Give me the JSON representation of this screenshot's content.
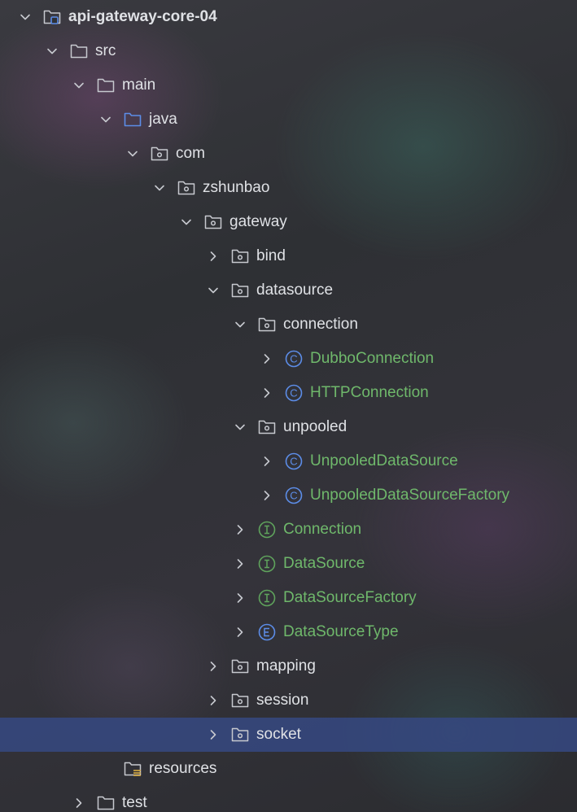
{
  "tree": {
    "items": [
      {
        "label": "api-gateway-core-04",
        "state": "expanded",
        "icon": "module-icon"
      },
      {
        "label": "src",
        "state": "expanded",
        "icon": "folder-icon"
      },
      {
        "label": "main",
        "state": "expanded",
        "icon": "folder-icon"
      },
      {
        "label": "java",
        "state": "expanded",
        "icon": "source-folder-icon"
      },
      {
        "label": "com",
        "state": "expanded",
        "icon": "package-icon"
      },
      {
        "label": "zshunbao",
        "state": "expanded",
        "icon": "package-icon"
      },
      {
        "label": "gateway",
        "state": "expanded",
        "icon": "package-icon"
      },
      {
        "label": "bind",
        "state": "collapsed",
        "icon": "package-icon"
      },
      {
        "label": "datasource",
        "state": "expanded",
        "icon": "package-icon"
      },
      {
        "label": "connection",
        "state": "expanded",
        "icon": "package-icon"
      },
      {
        "label": "DubboConnection",
        "state": "collapsed",
        "icon": "class-icon"
      },
      {
        "label": "HTTPConnection",
        "state": "collapsed",
        "icon": "class-icon"
      },
      {
        "label": "unpooled",
        "state": "expanded",
        "icon": "package-icon"
      },
      {
        "label": "UnpooledDataSource",
        "state": "collapsed",
        "icon": "class-icon"
      },
      {
        "label": "UnpooledDataSourceFactory",
        "state": "collapsed",
        "icon": "class-icon"
      },
      {
        "label": "Connection",
        "state": "collapsed",
        "icon": "interface-icon"
      },
      {
        "label": "DataSource",
        "state": "collapsed",
        "icon": "interface-icon"
      },
      {
        "label": "DataSourceFactory",
        "state": "collapsed",
        "icon": "interface-icon"
      },
      {
        "label": "DataSourceType",
        "state": "collapsed",
        "icon": "enum-icon"
      },
      {
        "label": "mapping",
        "state": "collapsed",
        "icon": "package-icon"
      },
      {
        "label": "session",
        "state": "collapsed",
        "icon": "package-icon"
      },
      {
        "label": "socket",
        "state": "collapsed",
        "icon": "package-icon",
        "selected": true
      },
      {
        "label": "resources",
        "state": "leaf",
        "icon": "resources-folder-icon"
      },
      {
        "label": "test",
        "state": "collapsed",
        "icon": "folder-icon"
      }
    ]
  },
  "colors": {
    "text": "#dfe1e5",
    "class_text": "#6fb86b",
    "selection": "#364880",
    "class_icon": "#5c8de8",
    "interface_icon": "#5fa35c",
    "enum_icon": "#5c8de8",
    "source_folder": "#5c8de8"
  }
}
